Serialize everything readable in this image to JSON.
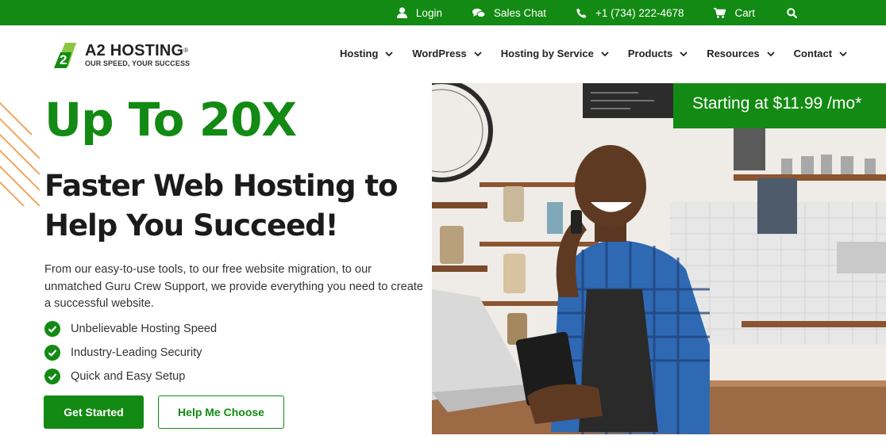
{
  "topbar": {
    "login": "Login",
    "sales_chat": "Sales Chat",
    "phone": "+1 (734) 222-4678",
    "cart": "Cart",
    "search_icon": "search-icon"
  },
  "logo": {
    "name": "A2 HOSTING",
    "registered": "®",
    "tagline": "OUR SPEED, YOUR SUCCESS",
    "mark": "2"
  },
  "nav": {
    "items": [
      {
        "label": "Hosting"
      },
      {
        "label": "WordPress"
      },
      {
        "label": "Hosting by Service"
      },
      {
        "label": "Products"
      },
      {
        "label": "Resources"
      },
      {
        "label": "Contact"
      }
    ]
  },
  "hero": {
    "title": "Up To 20X",
    "subtitle": "Faster Web Hosting to Help You Succeed!",
    "description": "From our easy-to-use tools, to our free website migration, to our unmatched Guru Crew Support, we provide everything you need to create a successful website.",
    "features": [
      "Unbelievable Hosting Speed",
      "Industry-Leading Security",
      "Quick and Easy Setup"
    ],
    "primary_button": "Get Started",
    "secondary_button": "Help Me Choose",
    "price_banner": "Starting at $11.99 /mo*"
  },
  "colors": {
    "brand_green": "#138a13",
    "accent_orange": "#f3a55a"
  }
}
